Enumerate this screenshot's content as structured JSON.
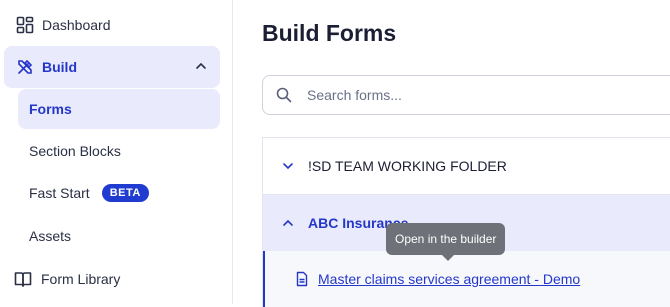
{
  "sidebar": {
    "dashboard": {
      "label": "Dashboard",
      "icon": "dashboard-grid-icon"
    },
    "build": {
      "label": "Build",
      "icon": "build-tools-icon",
      "expanded": true
    },
    "build_items": [
      {
        "label": "Forms",
        "active": true
      },
      {
        "label": "Section Blocks"
      },
      {
        "label": "Fast Start",
        "badge": "BETA"
      },
      {
        "label": "Assets"
      }
    ],
    "form_library": {
      "label": "Form Library",
      "icon": "book-icon"
    }
  },
  "main": {
    "title": "Build Forms",
    "search": {
      "placeholder": "Search forms...",
      "value": ""
    },
    "folders": [
      {
        "name": "!SD TEAM WORKING FOLDER",
        "expanded": false
      },
      {
        "name": "ABC Insurance",
        "expanded": true,
        "forms": [
          {
            "name": "Master claims services agreement - Demo"
          }
        ]
      }
    ],
    "tooltip": "Open in the builder"
  },
  "colors": {
    "accent": "#2437c9",
    "active_bg": "#e9eafb",
    "badge_bg": "#1f3bd0",
    "tooltip_bg": "#6e7178"
  }
}
